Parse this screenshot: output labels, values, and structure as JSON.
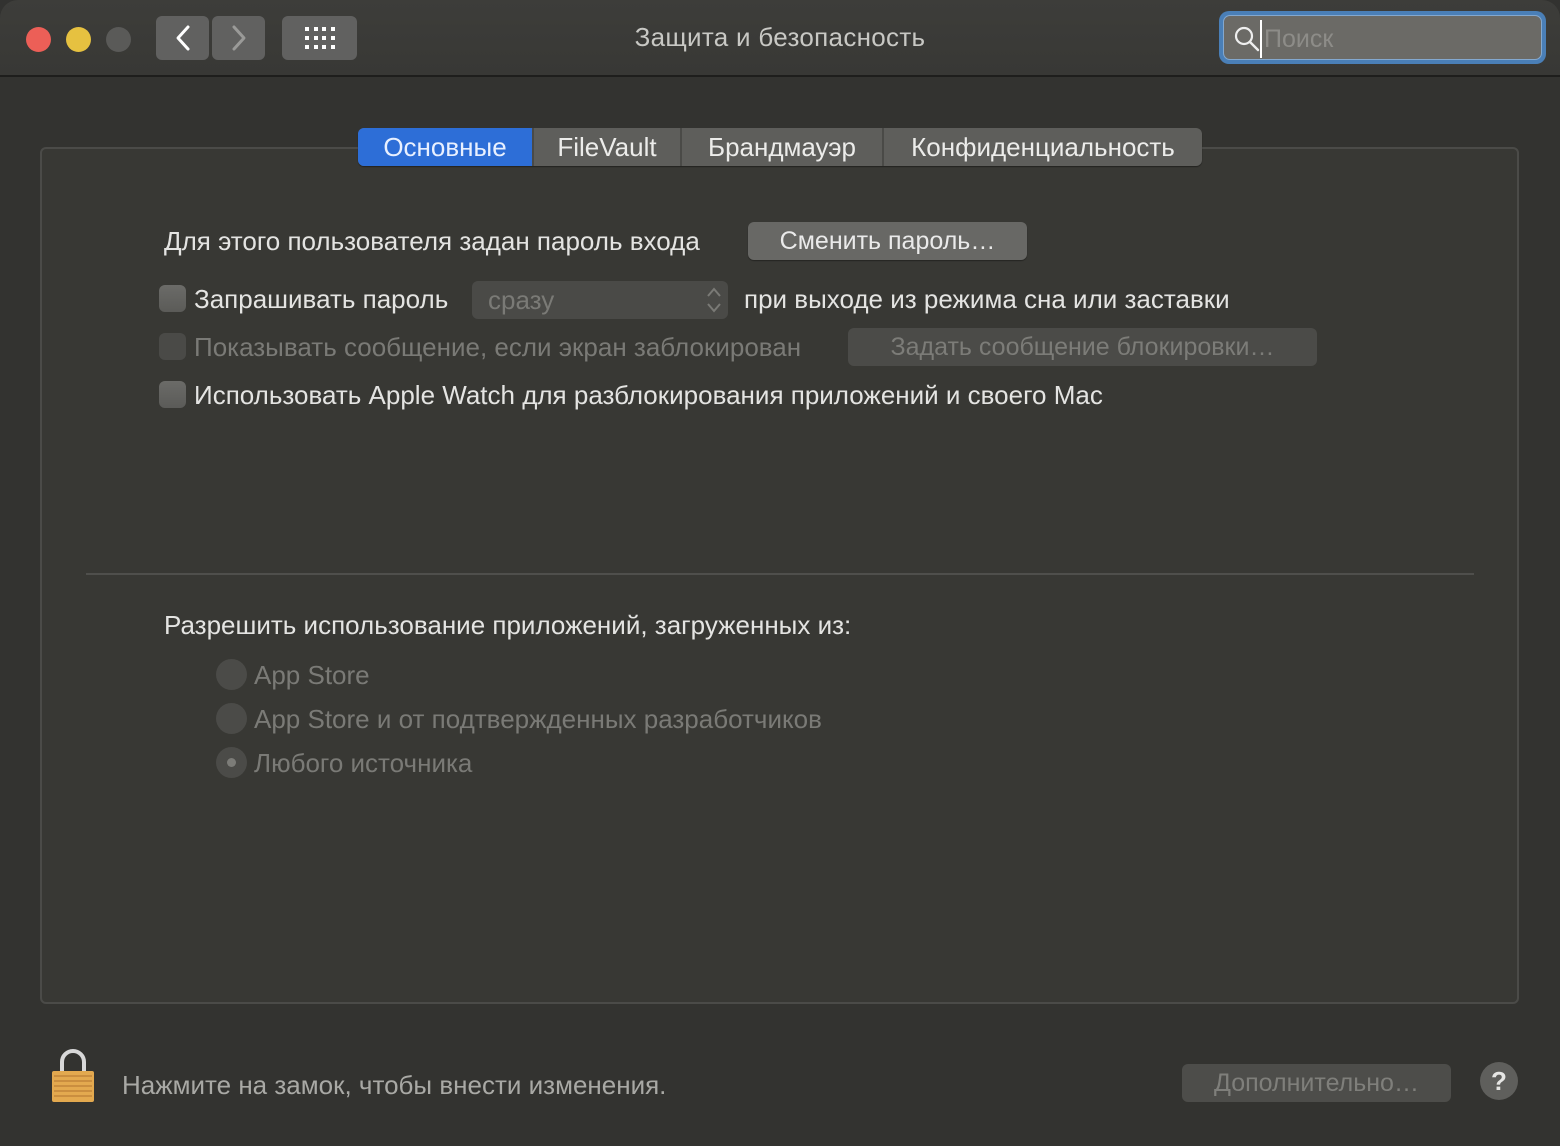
{
  "window": {
    "title": "Защита и безопасность",
    "traffic_lights": {
      "close": "#ec5f57",
      "minimize": "#e6c140",
      "zoom": "#5a5a58"
    },
    "nav": {
      "back_icon": "chevron-left-icon",
      "forward_icon": "chevron-right-icon",
      "grid_icon": "grid-icon"
    },
    "search": {
      "placeholder": "Поиск",
      "value": "",
      "icon": "search-icon"
    }
  },
  "tabs": [
    {
      "label": "Основные",
      "active": true
    },
    {
      "label": "FileVault",
      "active": false
    },
    {
      "label": "Брандмауэр",
      "active": false
    },
    {
      "label": "Конфиденциальность",
      "active": false
    }
  ],
  "general": {
    "password_set_label": "Для этого пользователя задан пароль входа",
    "change_password_button": "Сменить пароль…",
    "require_password": {
      "label": "Запрашивать пароль",
      "checked": false,
      "select_value": "сразу",
      "suffix": "при выходе из режима сна или заставки"
    },
    "show_message": {
      "label": "Показывать сообщение, если экран заблокирован",
      "checked": false,
      "disabled": true,
      "button": "Задать сообщение блокировки…"
    },
    "apple_watch": {
      "label": "Использовать Apple Watch для разблокирования приложений и своего Mac",
      "checked": false
    }
  },
  "allow_apps": {
    "heading": "Разрешить использование приложений, загруженных из:",
    "options": [
      {
        "label": "App Store",
        "selected": false
      },
      {
        "label": "App Store и от подтвержденных разработчиков",
        "selected": false
      },
      {
        "label": "Любого источника",
        "selected": true
      }
    ]
  },
  "footer": {
    "lock_icon": "lock-icon",
    "lock_text": "Нажмите на замок, чтобы внести изменения.",
    "advanced_button": "Дополнительно…",
    "help_label": "?"
  },
  "colors": {
    "accent": "#2d6ed7",
    "search_focus": "#4a7fb7",
    "background": "#333330"
  }
}
